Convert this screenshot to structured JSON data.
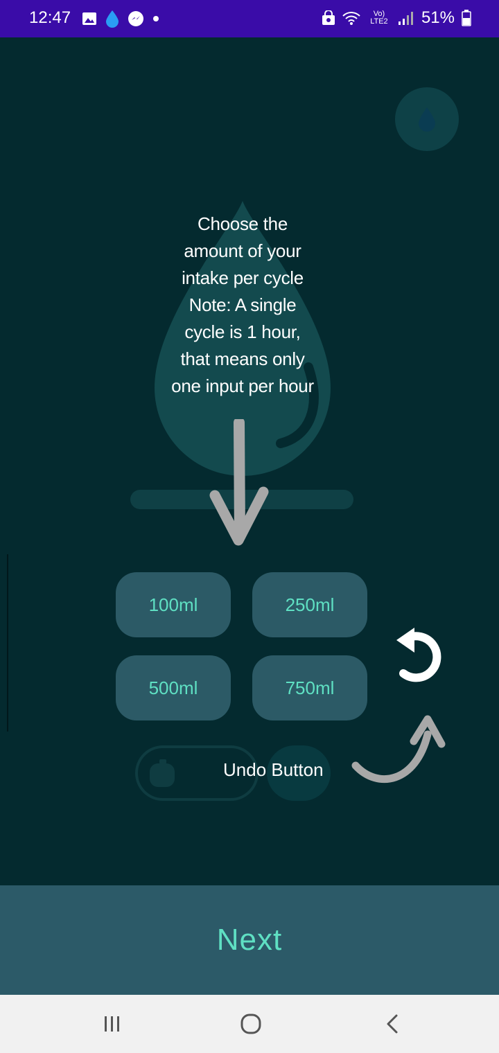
{
  "status_bar": {
    "time": "12:47",
    "network_label": "Vo) LTE2",
    "battery_percent": "51%"
  },
  "tutorial": {
    "instruction_lines": [
      "Choose the",
      "amount of your",
      "intake per cycle",
      "Note: A single",
      "cycle is 1 hour,",
      "that means only",
      "one input per hour"
    ],
    "undo_label": "Undo Button"
  },
  "amounts": {
    "btn_100": "100ml",
    "btn_250": "250ml",
    "btn_500": "500ml",
    "btn_750": "750ml"
  },
  "next_label": "Next",
  "colors": {
    "status_bar": "#3a0ca8",
    "background": "#042a2f",
    "button": "#2c5a66",
    "accent_text": "#5fe0c3",
    "next_bar": "#2c5a68"
  }
}
